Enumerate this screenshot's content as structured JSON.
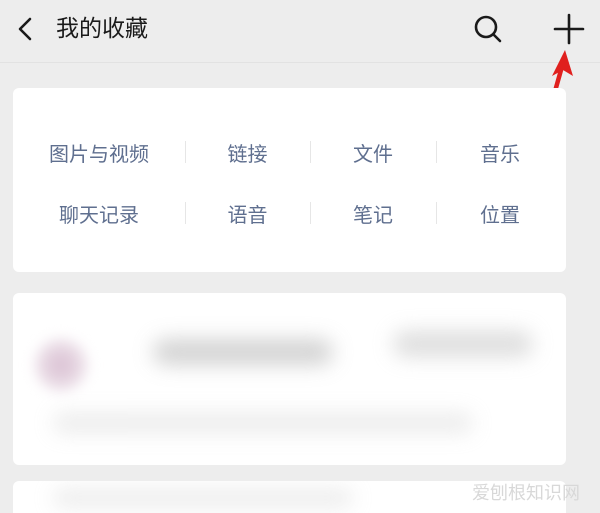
{
  "header": {
    "title": "我的收藏"
  },
  "categories": {
    "row1": [
      "图片与视频",
      "链接",
      "文件",
      "音乐"
    ],
    "row2": [
      "聊天记录",
      "语音",
      "笔记",
      "位置"
    ]
  },
  "watermark": "爱刨根知识网",
  "colors": {
    "background": "#ededed",
    "card": "#ffffff",
    "category_text": "#5f6f8f",
    "title_text": "#1a1a1a",
    "annotation_arrow": "#e0201e"
  },
  "icons": {
    "back": "chevron-left-icon",
    "search": "search-icon",
    "add": "plus-icon",
    "annotation": "red-arrow-icon"
  }
}
